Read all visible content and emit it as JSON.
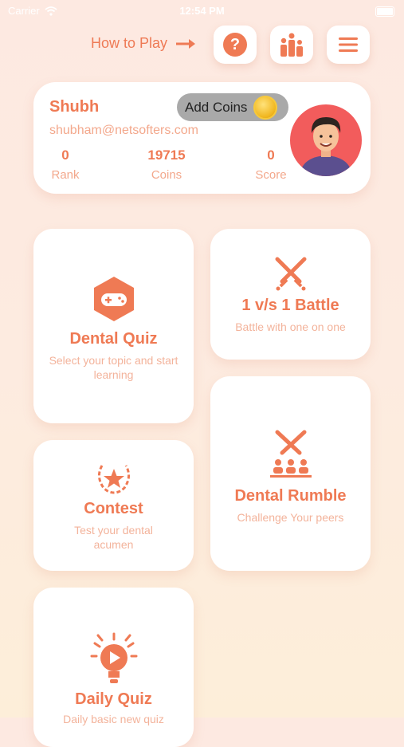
{
  "status": {
    "carrier": "Carrier",
    "time": "12:54 PM"
  },
  "header": {
    "how_to_play": "How to Play"
  },
  "profile": {
    "name": "Shubh",
    "email": "shubham@netsofters.com",
    "add_coins_label": "Add Coins",
    "stats": [
      {
        "value": "0",
        "label": "Rank"
      },
      {
        "value": "19715",
        "label": "Coins"
      },
      {
        "value": "0",
        "label": "Score"
      }
    ]
  },
  "cards": {
    "dental_quiz": {
      "title": "Dental Quiz",
      "subtitle": "Select your topic and start learning",
      "icon": "gamepad-icon"
    },
    "battle": {
      "title": "1 v/s 1 Battle",
      "subtitle": "Battle with one on one",
      "icon": "crossed-swords-icon"
    },
    "contest": {
      "title": "Contest",
      "subtitle": "Test your dental acumen",
      "icon": "laurel-star-icon"
    },
    "rumble": {
      "title": "Dental Rumble",
      "subtitle": "Challenge Your peers",
      "icon": "swords-group-icon"
    },
    "daily_quiz": {
      "title": "Daily Quiz",
      "subtitle": "Daily basic new quiz",
      "icon": "bulb-play-icon"
    }
  },
  "colors": {
    "accent": "#ef7a54",
    "muted": "#f3a88c",
    "background": "#fde9e1",
    "avatar_bg": "#f25c5c"
  }
}
